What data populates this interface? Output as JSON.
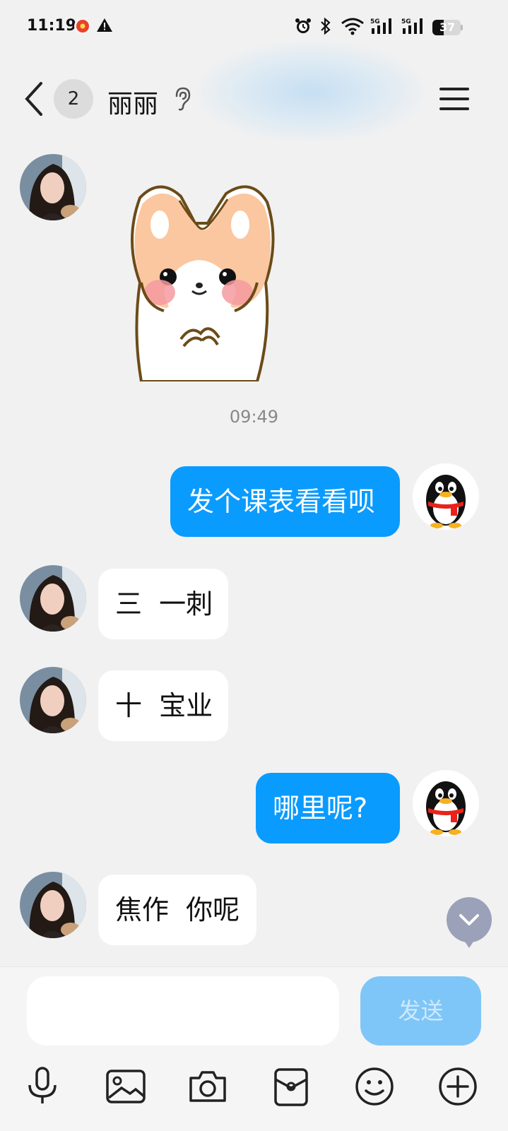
{
  "status_bar": {
    "time": "11:19",
    "battery": "37"
  },
  "header": {
    "unread_count": "2",
    "contact_name": "丽丽"
  },
  "messages": [
    {
      "side": "in",
      "kind": "sticker"
    },
    {
      "kind": "timestamp",
      "text": "09:49"
    },
    {
      "side": "out",
      "text": "发个课表看看呗"
    },
    {
      "side": "in",
      "text": "三  一刺"
    },
    {
      "side": "in",
      "text": "十  宝业"
    },
    {
      "side": "out",
      "text": "哪里呢?"
    },
    {
      "side": "in",
      "text": "焦作  你呢"
    }
  ],
  "composer": {
    "input_value": "",
    "send_label": "发送"
  },
  "toolbar": {
    "icons": [
      "microphone-icon",
      "image-icon",
      "camera-icon",
      "file-icon",
      "emoji-icon",
      "plus-icon"
    ]
  },
  "colors": {
    "out_bubble": "#0a9bff",
    "send_disabled": "#7fc6f8",
    "background": "#f1f1f1"
  }
}
